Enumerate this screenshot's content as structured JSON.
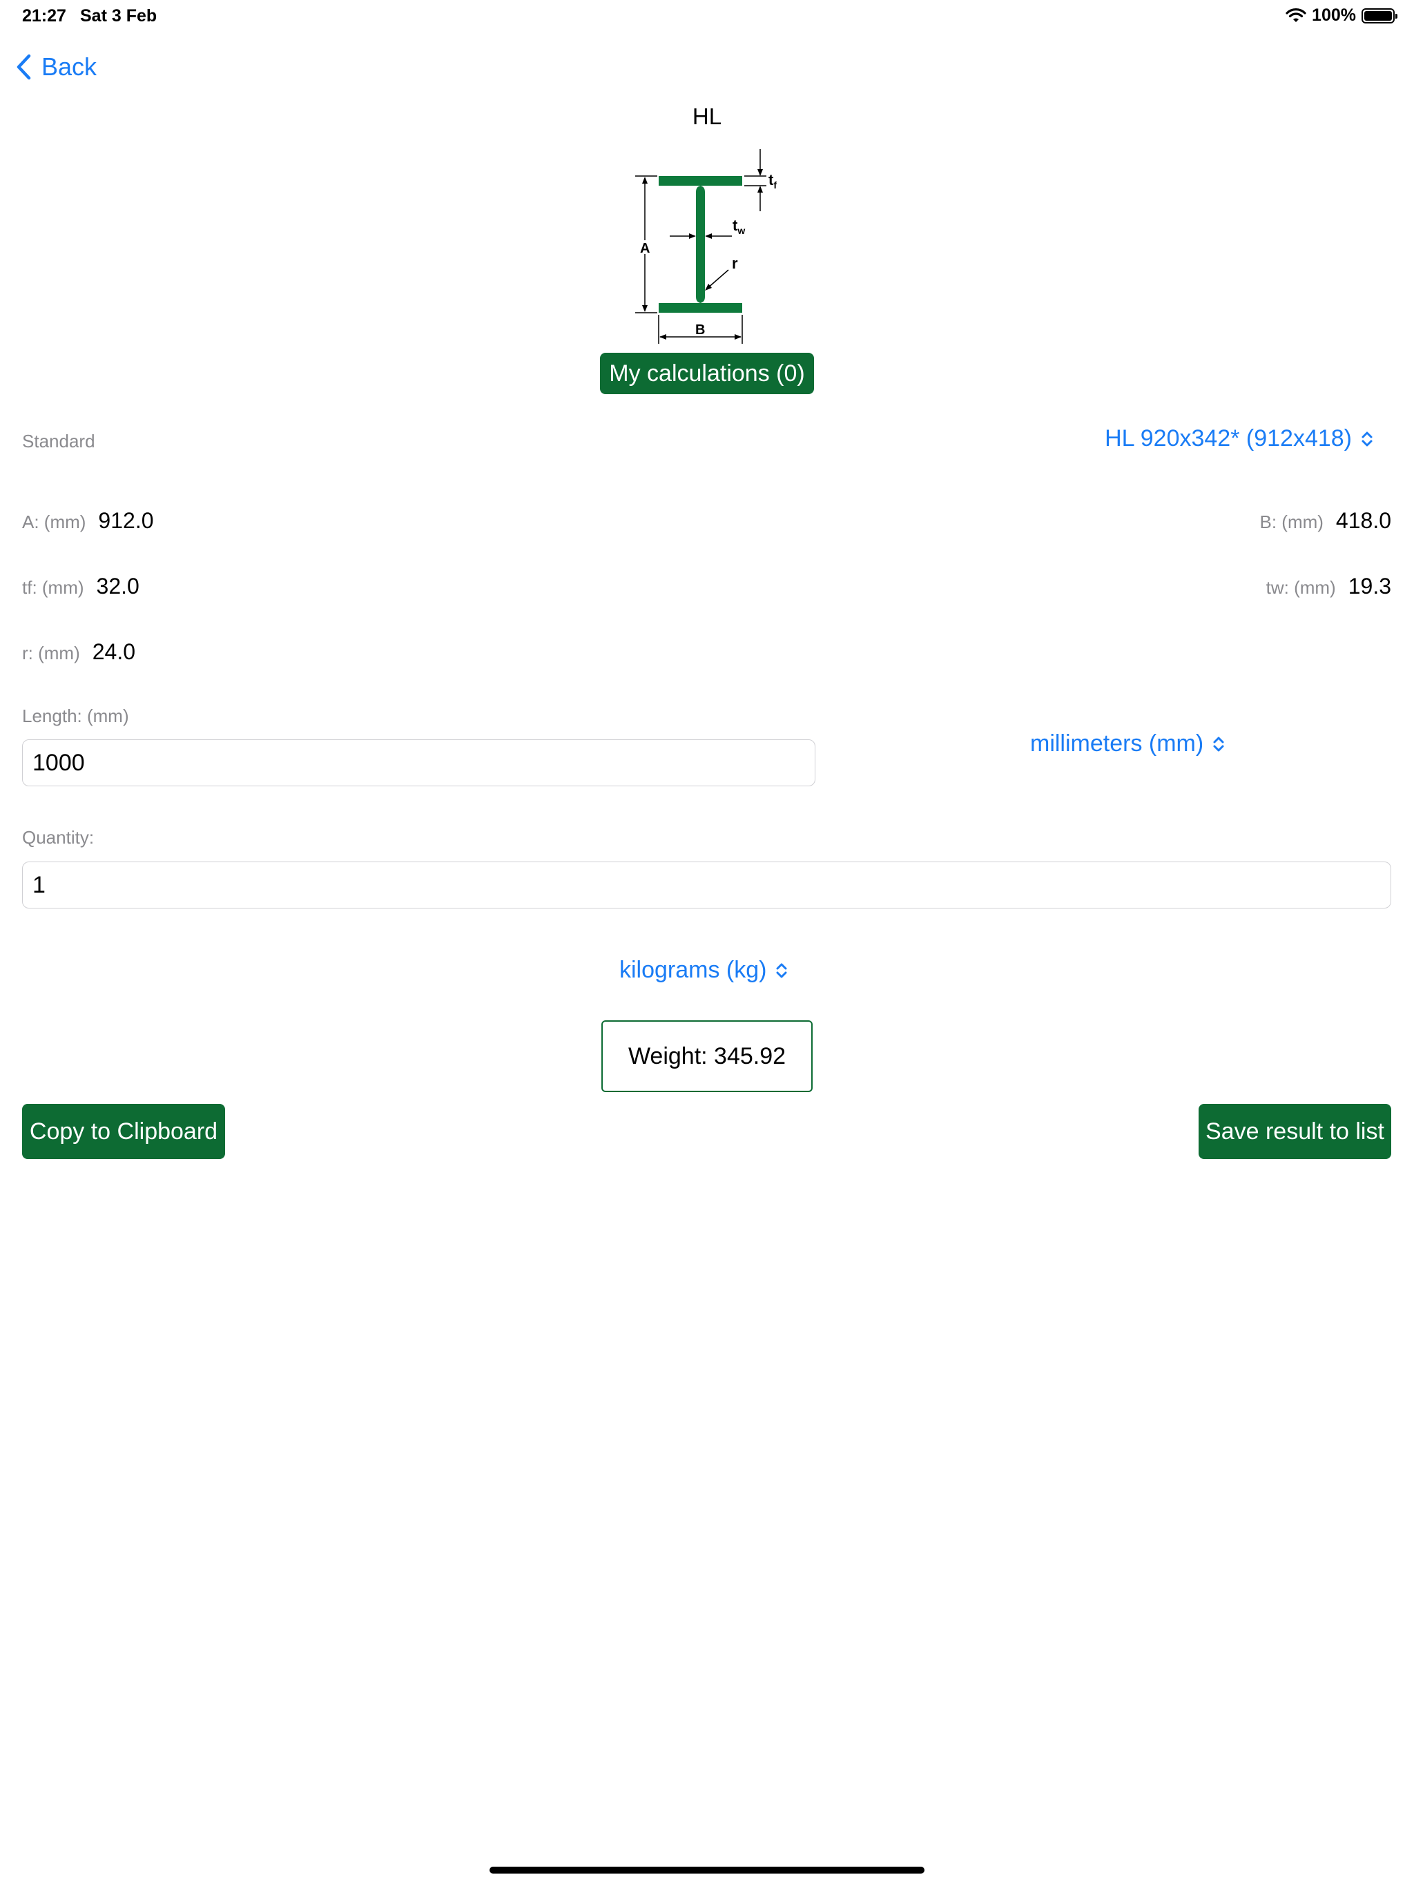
{
  "status": {
    "time": "21:27",
    "date": "Sat 3 Feb",
    "battery": "100%"
  },
  "nav": {
    "back_label": "Back"
  },
  "title": "HL",
  "diagram_labels": {
    "a": "A",
    "b": "B",
    "tf": "t",
    "tf_sub": "f",
    "tw": "t",
    "tw_sub": "w",
    "r": "r"
  },
  "my_calculations_label": "My calculations (0)",
  "standard": {
    "label": "Standard",
    "value": "HL 920x342* (912x418)"
  },
  "dimensions": {
    "a": {
      "label": "A: (mm)",
      "value": "912.0"
    },
    "b": {
      "label": "B: (mm)",
      "value": "418.0"
    },
    "tf": {
      "label": "tf: (mm)",
      "value": "32.0"
    },
    "tw": {
      "label": "tw: (mm)",
      "value": "19.3"
    },
    "r": {
      "label": "r: (mm)",
      "value": "24.0"
    }
  },
  "length": {
    "label": "Length: (mm)",
    "value": "1000",
    "unit": "millimeters (mm)"
  },
  "quantity": {
    "label": "Quantity:",
    "value": "1"
  },
  "weight_unit": "kilograms (kg)",
  "weight_result": "Weight: 345.92",
  "actions": {
    "copy_label": "Copy to Clipboard",
    "save_label": "Save result to list"
  },
  "colors": {
    "accent_green": "#0d6b33",
    "link_blue": "#1a7cf5",
    "diagram_green": "#0e7a3c"
  },
  "icons": {
    "wifi": "wifi-icon",
    "battery": "battery-icon",
    "back": "chevron-left-icon",
    "select": "chevron-up-down-icon"
  }
}
